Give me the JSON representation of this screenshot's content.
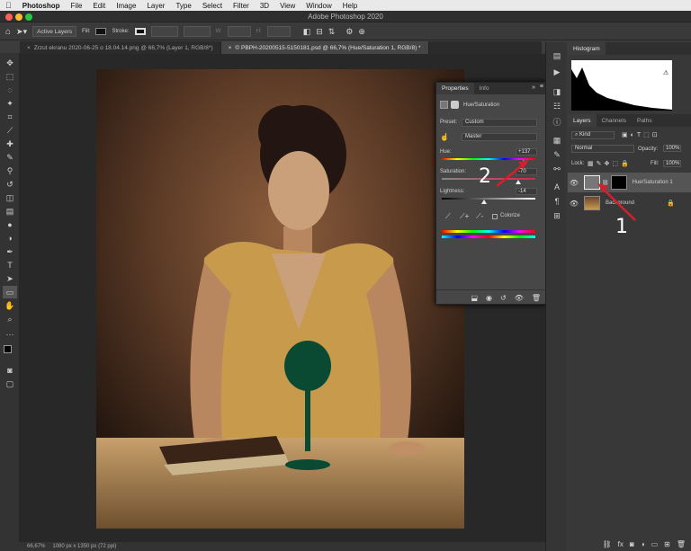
{
  "menubar": {
    "app_name": "Photoshop",
    "items": [
      "File",
      "Edit",
      "Image",
      "Layer",
      "Type",
      "Select",
      "Filter",
      "3D",
      "View",
      "Window",
      "Help"
    ]
  },
  "window": {
    "title": "Adobe Photoshop 2020"
  },
  "options_bar": {
    "auto_select": "Active Layers",
    "fill_label": "Fill:",
    "stroke_label": "Stroke:",
    "w_label": "W:",
    "h_label": "H:"
  },
  "tabs": [
    {
      "label": "Zrzut ekranu 2020-06-25 o 18.04.14.png @ 66,7% (Layer 1, RGB/8*)",
      "active": false
    },
    {
      "label": "© PBPH-20200515-5150181.psd @ 66,7% (Hue/Saturation 1, RGB/8) *",
      "active": true
    }
  ],
  "status": {
    "zoom": "66,67%",
    "doc_info": "1080 px x 1350 px (72 ppi)"
  },
  "histogram": {
    "title": "Histogram"
  },
  "layers_panel": {
    "tabs": [
      "Layers",
      "Channels",
      "Paths"
    ],
    "kind": "Kind",
    "blend_mode": "Normal",
    "opacity_label": "Opacity:",
    "opacity": "100%",
    "lock_label": "Lock:",
    "fill_label": "Fill:",
    "fill": "100%",
    "layers": [
      {
        "name": "Hue/Saturation 1"
      },
      {
        "name": "Background"
      }
    ]
  },
  "properties": {
    "tabs": [
      "Properties",
      "Info"
    ],
    "adjustment": "Hue/Saturation",
    "preset_label": "Preset:",
    "preset": "Custom",
    "channel": "Master",
    "hue_label": "Hue:",
    "hue": "+137",
    "saturation_label": "Saturation:",
    "saturation": "-70",
    "lightness_label": "Lightness:",
    "lightness": "-14",
    "colorize_label": "Colorize"
  },
  "annotations": {
    "one": "1",
    "two": "2",
    "color": "#d4202a"
  }
}
